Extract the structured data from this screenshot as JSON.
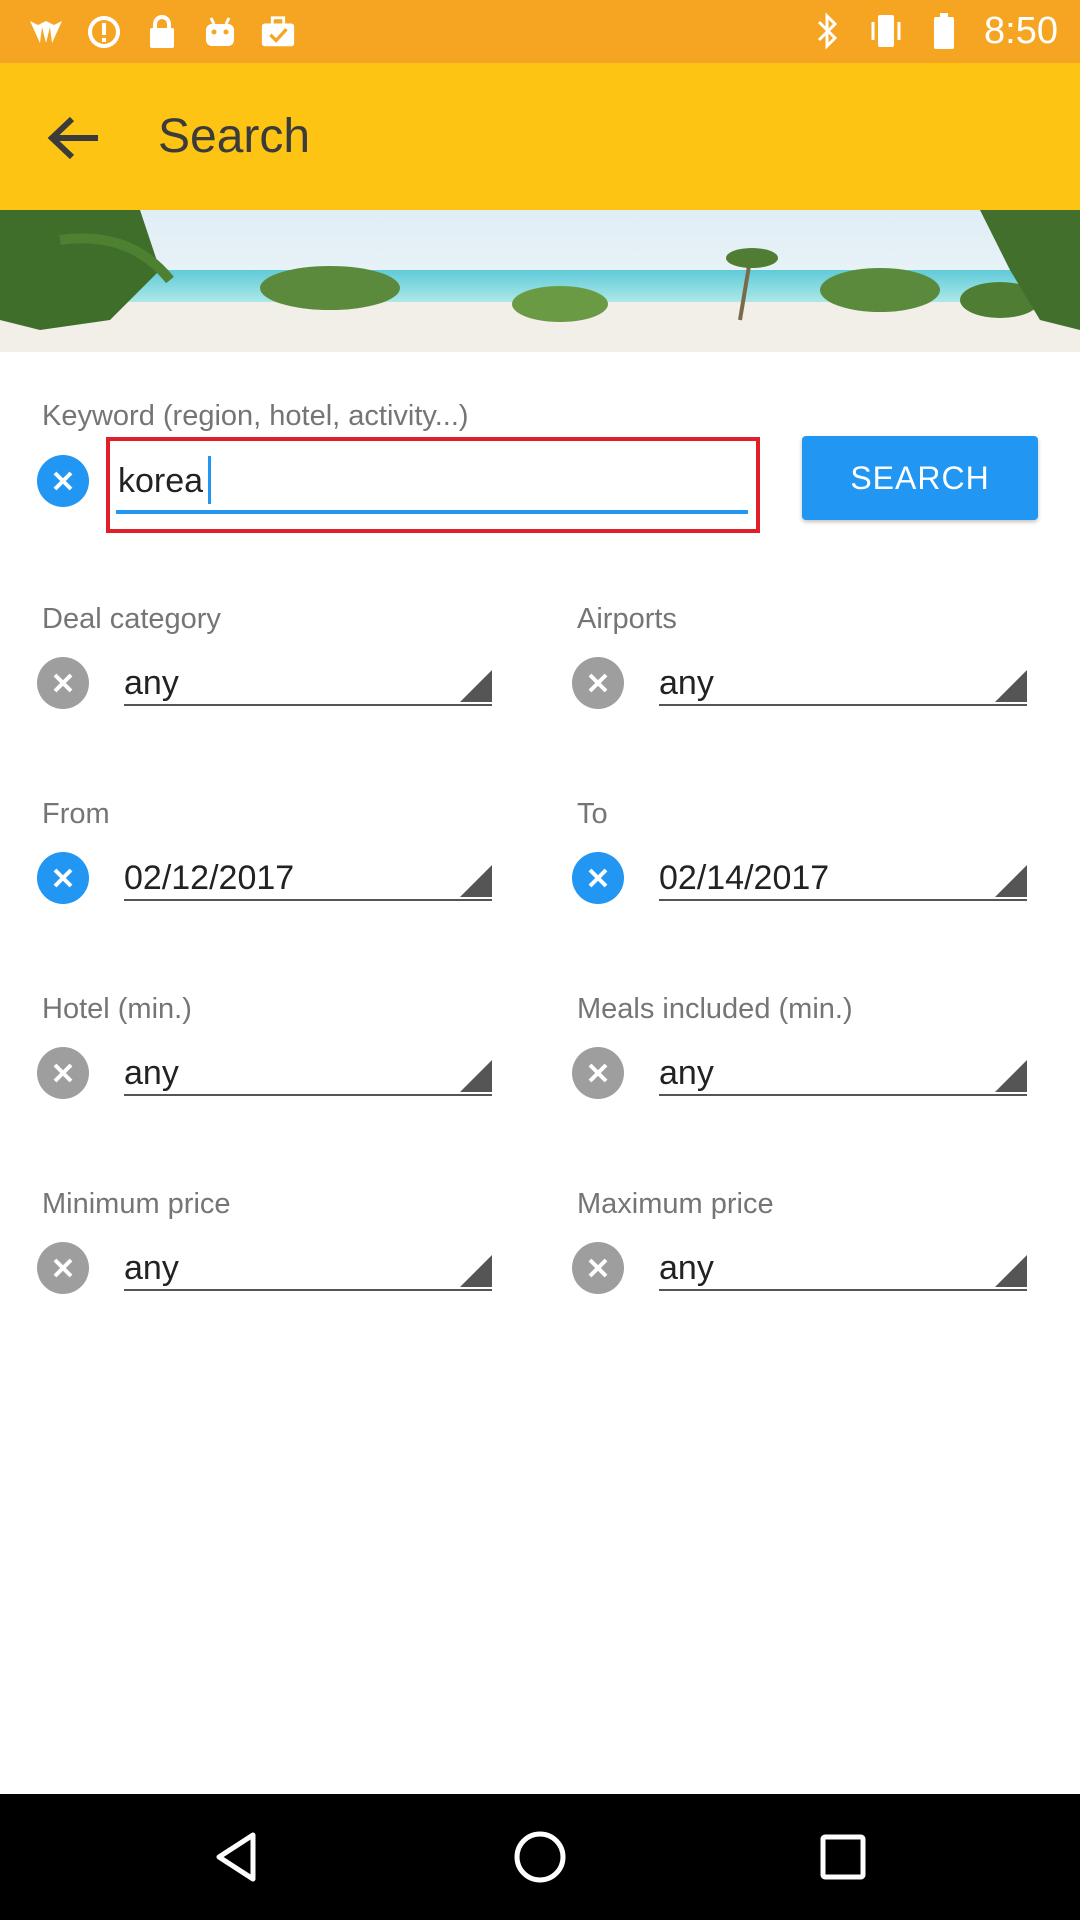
{
  "status_bar": {
    "time": "8:50",
    "icons_left": [
      "app-notification-icon",
      "alert-circle-icon",
      "lock-icon",
      "android-icon",
      "briefcase-check-icon"
    ],
    "icons_right": [
      "bluetooth-icon",
      "vibrate-icon",
      "battery-icon"
    ],
    "color": "#f6a523"
  },
  "app_bar": {
    "title": "Search",
    "color": "#fec414"
  },
  "keyword": {
    "label": "Keyword (region, hotel, activity...)",
    "value": "korea",
    "search_label": "SEARCH"
  },
  "fields": [
    {
      "label": "Deal category",
      "value": "any",
      "active": false
    },
    {
      "label": "Airports",
      "value": "any",
      "active": false
    },
    {
      "label": "From",
      "value": "02/12/2017",
      "active": true
    },
    {
      "label": "To",
      "value": "02/14/2017",
      "active": true
    },
    {
      "label": "Hotel (min.)",
      "value": "any",
      "active": false
    },
    {
      "label": "Meals included (min.)",
      "value": "any",
      "active": false
    },
    {
      "label": "Minimum price",
      "value": "any",
      "active": false
    },
    {
      "label": "Maximum price",
      "value": "any",
      "active": false
    }
  ],
  "colors": {
    "accent": "#2196f3",
    "highlight_border": "#e01f26",
    "clear_inactive": "#9e9e9e"
  }
}
